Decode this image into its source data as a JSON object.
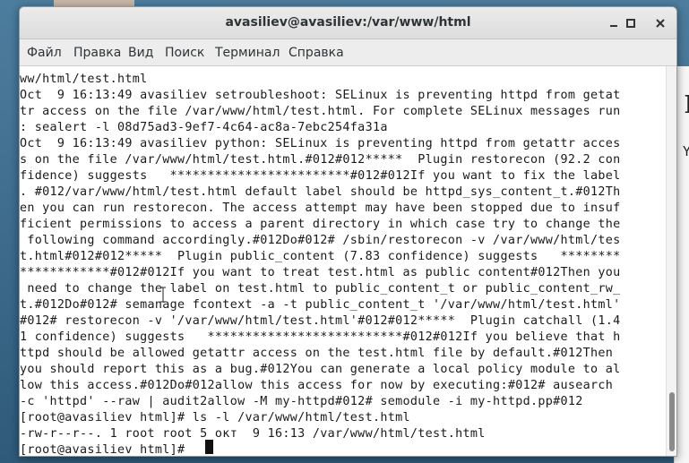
{
  "window": {
    "title": "avasiliev@avasiliev:/var/www/html",
    "controls": [
      "minimize-icon",
      "maximize-icon",
      "close-icon"
    ]
  },
  "menu": [
    "Файл",
    "Правка",
    "Вид",
    "Поиск",
    "Терминал",
    "Справка"
  ],
  "terminal": {
    "lines": [
      "ww/html/test.html",
      "Oct  9 16:13:49 avasiliev setroubleshoot: SELinux is preventing httpd from getat",
      "tr access on the file /var/www/html/test.html. For complete SELinux messages run",
      ": sealert -l 08d75ad3-9ef7-4c64-ac8a-7ebc254fa31a",
      "Oct  9 16:13:49 avasiliev python: SELinux is preventing httpd from getattr acces",
      "s on the file /var/www/html/test.html.#012#012*****  Plugin restorecon (92.2 con",
      "fidence) suggests   ************************#012#012If you want to fix the label",
      ". #012/var/www/html/test.html default label should be httpd_sys_content_t.#012Th",
      "en you can run restorecon. The access attempt may have been stopped due to insuf",
      "ficient permissions to access a parent directory in which case try to change the",
      " following command accordingly.#012Do#012# /sbin/restorecon -v /var/www/html/tes",
      "t.html#012#012*****  Plugin public_content (7.83 confidence) suggests   ********",
      "************#012#012If you want to treat test.html as public content#012Then you",
      " need to change the label on test.html to public_content_t or public_content_rw_",
      "t.#012Do#012# semanage fcontext -a -t public_content_t '/var/www/html/test.html'",
      "#012# restorecon -v '/var/www/html/test.html'#012#012*****  Plugin catchall (1.4",
      "1 confidence) suggests   **************************#012#012If you believe that h",
      "ttpd should be allowed getattr access on the test.html file by default.#012Then",
      "you should report this as a bug.#012You can generate a local policy module to al",
      "low this access.#012Do#012allow this access for now by executing:#012# ausearch",
      "-c 'httpd' --raw | audit2allow -M my-httpd#012# semodule -i my-httpd.pp#012",
      "[root@avasiliev html]# ls -l /var/www/html/test.html",
      "-rw-r--r--. 1 root root 5 окт  9 16:13 /var/www/html/test.html",
      "[root@avasiliev html]# "
    ]
  },
  "background_window": {
    "visible_chars": [
      "]",
      "Y"
    ]
  },
  "colors": {
    "terminal_bg": "#ffffff",
    "terminal_fg": "#1a1a1a",
    "titlebar_bg": "#e4e4e4",
    "desktop_bg": "#3e6b8c"
  }
}
